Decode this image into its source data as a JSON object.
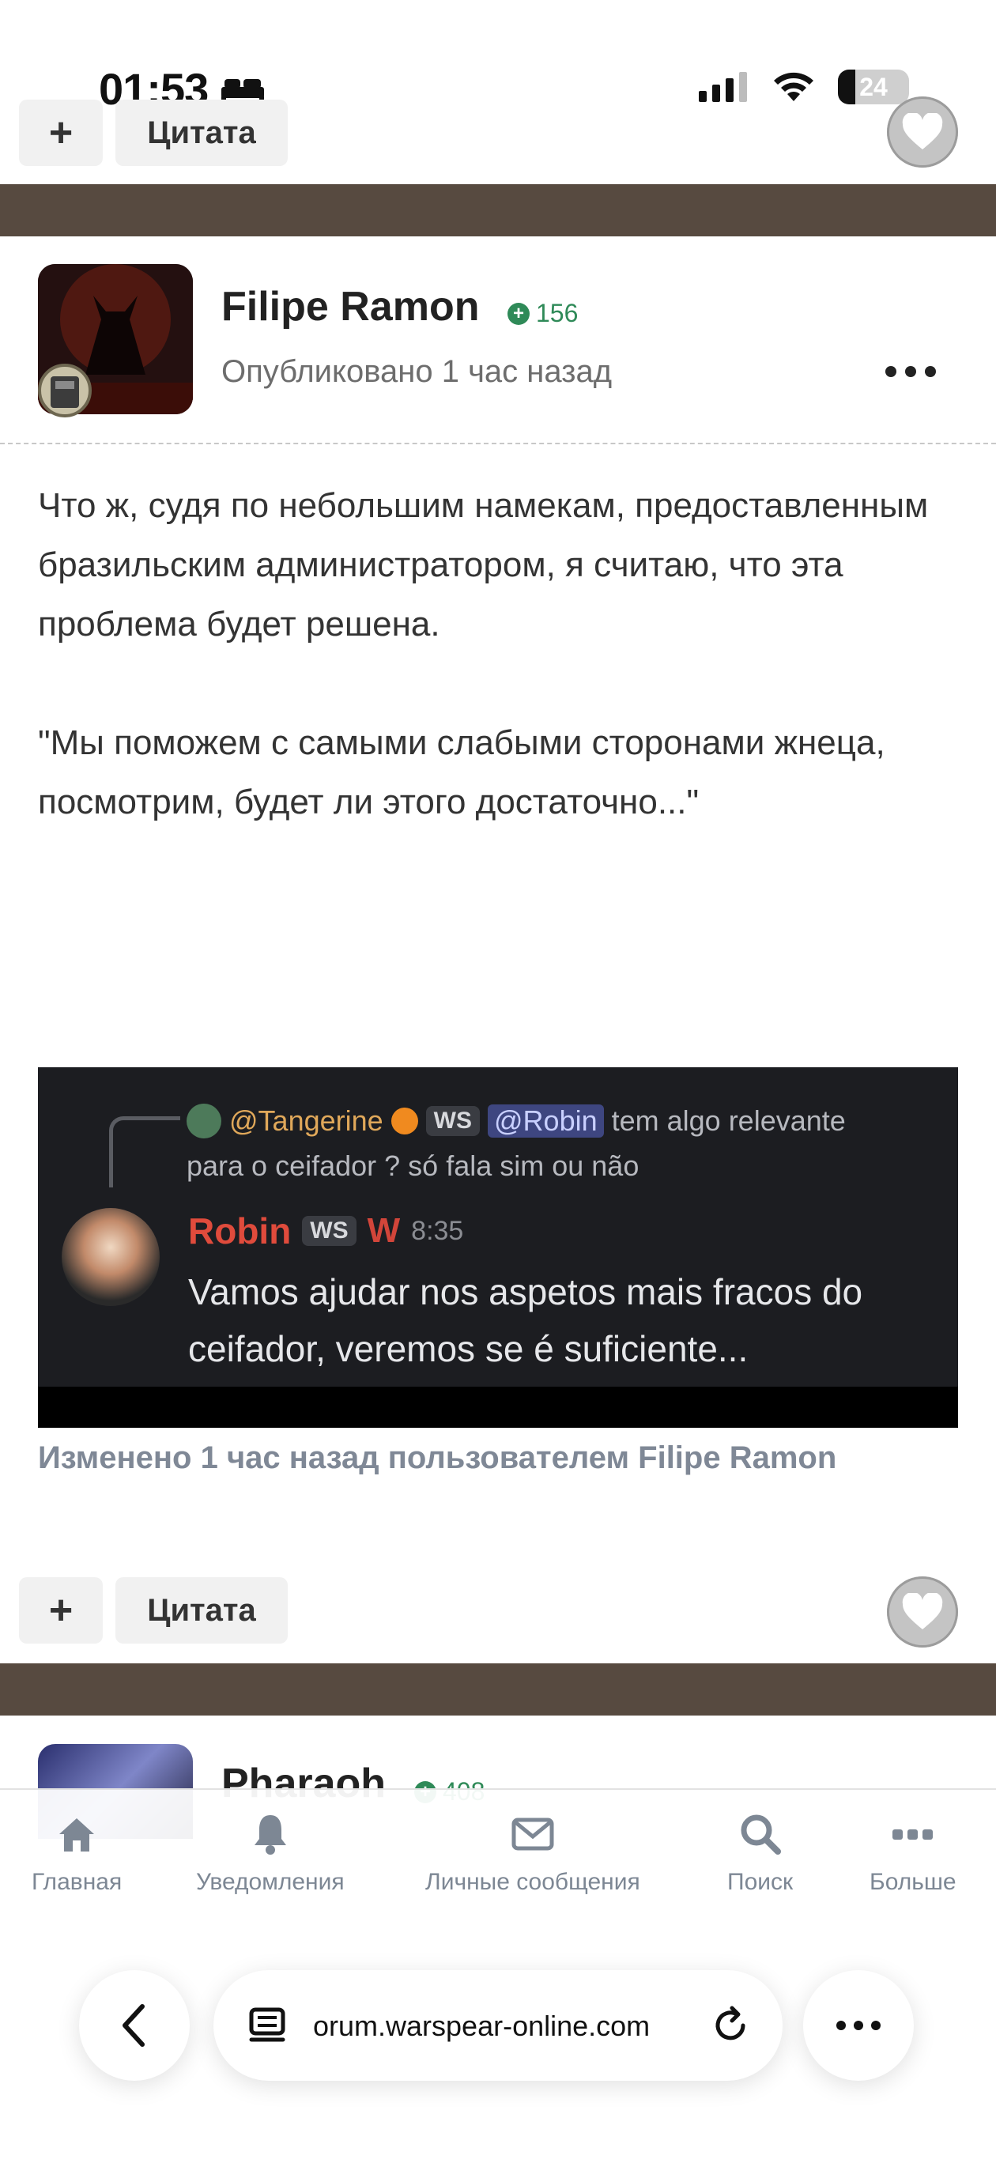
{
  "status": {
    "time": "01:53",
    "battery": "24"
  },
  "top_actions": {
    "plus": "+",
    "quote": "Цитата"
  },
  "post": {
    "author": "Filipe Ramon",
    "reputation": "156",
    "published": "Опубликовано 1 час назад",
    "paragraphs": [
      "Что ж, судя по небольшим намекам, предоставленным бразильским администратором, я считаю, что эта проблема будет решена.",
      "\"Мы поможем с самыми слабыми сторонами жнеца, посмотрим, будет ли этого достаточно...\""
    ],
    "embedded_chat": {
      "reply_user": "@Tangerine",
      "reply_tag": "WS",
      "reply_mention": "@Robin",
      "reply_text_1": "tem algo relevante",
      "reply_text_2": "para o ceifador ? só fala sim ou não",
      "author": "Robin",
      "author_tag": "WS",
      "author_badge": "W",
      "time": "8:35",
      "message": "Vamos ajudar nos aspetos mais fracos do ceifador, veremos se é suficiente..."
    },
    "edited": "Изменено 1 час назад пользователем Filipe Ramon",
    "actions": {
      "plus": "+",
      "quote": "Цитата"
    }
  },
  "next_post": {
    "author": "Pharaoh",
    "reputation": "408"
  },
  "tabs": [
    {
      "label": "Главная",
      "icon": "home-icon"
    },
    {
      "label": "Уведомления",
      "icon": "bell-icon"
    },
    {
      "label": "Личные сообщения",
      "icon": "mail-icon"
    },
    {
      "label": "Поиск",
      "icon": "search-icon"
    },
    {
      "label": "Больше",
      "icon": "more-icon"
    }
  ],
  "browser": {
    "url": "orum.warspear-online.com"
  },
  "colors": {
    "divider": "#574a40",
    "reputation": "#2f8a58",
    "robin": "#e04b3c",
    "tab_text": "#7d8794"
  }
}
